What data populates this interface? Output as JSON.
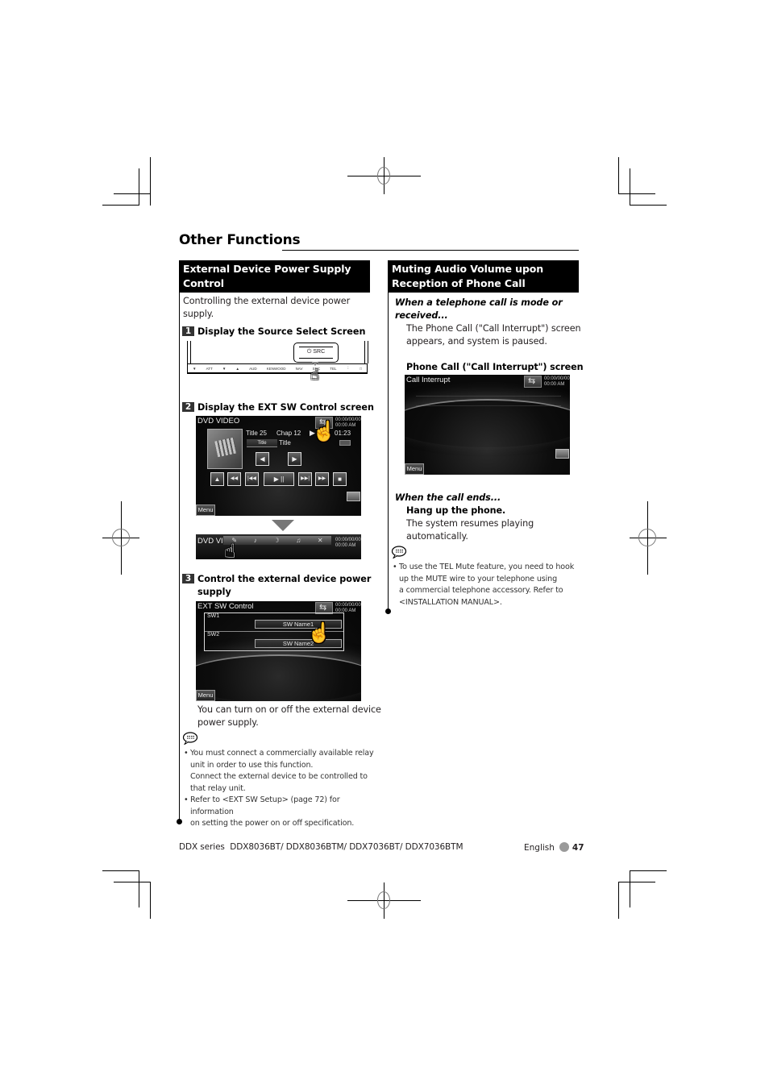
{
  "page": {
    "title": "Other Functions",
    "footer": {
      "series": "DDX series",
      "models": "DDX8036BT/ DDX8036BTM/ DDX7036BT/ DDX7036BTM",
      "language": "English",
      "page_number": "47"
    }
  },
  "left_section": {
    "heading_line1": "External Device Power Supply",
    "heading_line2": "Control",
    "intro_line1": "Controlling the external device power",
    "intro_line2": "supply.",
    "steps": [
      {
        "number": "1",
        "label": "Display the Source Select Screen"
      },
      {
        "number": "2",
        "label": "Display the EXT SW Control screen"
      },
      {
        "number": "3",
        "label_line1": "Control the external device power",
        "label_line2": "supply"
      }
    ],
    "source_bar": {
      "src_button": "SRC",
      "src_icon": "power-icon",
      "items": [
        "▼",
        "ATT",
        "▼",
        "▲",
        "AUD",
        "KENWOOD",
        "NAV",
        "SRC",
        "TEL",
        "⋮",
        "□"
      ]
    },
    "dvd_screen": {
      "title": "DVD VIDEO",
      "clock_line1": "00:00/00/00",
      "clock_line2": "00:00 AM",
      "title_num": "Title  25",
      "chap_num": "Chap  12",
      "time": "01:23",
      "title_btn": "Title",
      "title_text": "Title",
      "transport": [
        "▲",
        "◀◀",
        "|◀◀",
        "▶ ||",
        "▶▶|",
        "▶▶",
        "■"
      ],
      "menu": "Menu"
    },
    "dvd_bar": {
      "title": "DVD VI",
      "clock_line1": "00:00/00/00",
      "clock_line2": "00:00 AM"
    },
    "ext_screen": {
      "title": "EXT SW Control",
      "clock_line1": "00:00/00/00",
      "clock_line2": "00:00 AM",
      "sw1_label": "SW1",
      "sw1_button": "SW Name1",
      "sw2_label": "SW2",
      "sw2_button": "SW Name2",
      "menu": "Menu"
    },
    "result_line1": "You can turn on or off the external device",
    "result_line2": "power supply.",
    "notes": [
      {
        "bullet": "•",
        "line1": "You must connect a commercially available relay",
        "line2": "unit in order to use this function.",
        "line3": "Connect the external device to be controlled to",
        "line4": "that relay unit."
      },
      {
        "bullet": "•",
        "line1": "Refer to <EXT SW Setup> (page 72) for information",
        "line2": "on setting the power on or off specification."
      }
    ]
  },
  "right_section": {
    "heading_line1": "Muting Audio Volume upon",
    "heading_line2": "Reception of Phone Call",
    "when_received_line1": "When a telephone call is mode or",
    "when_received_line2": "received...",
    "received_desc_line1": "The Phone Call (\"Call Interrupt\") screen",
    "received_desc_line2": "appears, and system is paused.",
    "screen_caption": "Phone Call (\"Call Interrupt\") screen",
    "call_screen": {
      "title": "Call Interrupt",
      "clock_line1": "00:00/00/00",
      "clock_line2": "00:00 AM",
      "menu": "Menu"
    },
    "when_ends": "When the call ends...",
    "hang_up": "Hang up the phone.",
    "resume_line1": "The system resumes playing",
    "resume_line2": "automatically.",
    "note": {
      "bullet": "•",
      "line1": "To use the TEL Mute feature, you need to hook",
      "line2": "up the MUTE wire to your telephone using",
      "line3": "a commercial telephone accessory. Refer to",
      "line4": "<INSTALLATION MANUAL>."
    }
  }
}
